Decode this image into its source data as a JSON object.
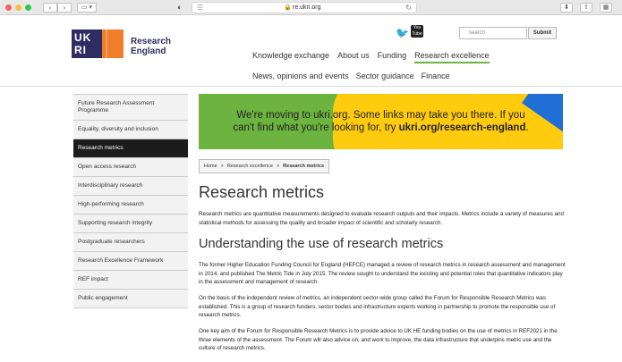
{
  "browser": {
    "url": "re.ukri.org",
    "colors": {
      "close": "#fc605c",
      "minimize": "#fdbc40",
      "maximize": "#34c84a"
    },
    "icons": [
      "back-icon",
      "forward-icon",
      "sidebar-icon",
      "shield-icon",
      "menu-icon",
      "lock-icon",
      "reload-icon",
      "download-icon",
      "share-icon",
      "tabs-icon"
    ]
  },
  "header": {
    "logo_mark": "UK RI",
    "logo_text": "Research England",
    "search_placeholder": "search",
    "submit_label": "Submit",
    "nav": [
      {
        "label": "Knowledge exchange"
      },
      {
        "label": "About us"
      },
      {
        "label": "Funding"
      },
      {
        "label": "Research excellence",
        "active": true
      }
    ],
    "subnav": [
      {
        "label": "News, opinions and events"
      },
      {
        "label": "Sector guidance"
      },
      {
        "label": "Finance"
      }
    ],
    "accent": "#6cb33f"
  },
  "sidebar": {
    "items": [
      {
        "label": "Future Research Assessment Programme"
      },
      {
        "label": "Equality, diversity and inclusion"
      },
      {
        "label": "Research metrics",
        "active": true
      },
      {
        "label": "Open access research"
      },
      {
        "label": "Interdisciplinary research"
      },
      {
        "label": "High-performing research"
      },
      {
        "label": "Supporting research integrity"
      },
      {
        "label": "Postgraduate researchers"
      },
      {
        "label": "Research Excellence Framework"
      },
      {
        "label": "REF impact"
      },
      {
        "label": "Public engagement"
      }
    ]
  },
  "banner": {
    "line1": "We're moving to ukri.org. Some links may take you there. If you",
    "line2_prefix": "can't find what you're looking for, try ",
    "line2_link": "ukri.org/research-england",
    "line2_suffix": "."
  },
  "breadcrumb": {
    "items": [
      "Home",
      "Research excellence",
      "Research metrics"
    ],
    "separator": ">"
  },
  "main": {
    "title": "Research metrics",
    "intro": "Research metrics are quantitative measurements designed to evaluate research outputs and their impacts. Metrics include a variety of measures and statistical methods for assessing the quality and broader impact of scientific and scholarly research.",
    "subtitle": "Understanding the use of research metrics",
    "para1": "The former Higher Education Funding Council for England (HEFCE) managed a review of research metrics in research assessment and management in 2014, and published The Metric Tide in July 2015. The review sought to understand the existing and potential roles that quantitative indicators play in the assessment and management of research.",
    "para2": "On the basis of the independent review of metrics, an independent sector-wide group called the Forum for Responsible Research Metrics was established. This is a group of research funders, sector bodies and infrastructure experts working in partnership to promote the responsible use of research metrics.",
    "para3": "One key aim of the Forum for Responsible Research Metrics is to provide advice to UK HE funding bodies on the use of metrics in REF2021 in the three elements of the assessment. The Forum will also advice on, and work to improve, the data infrastructure that underpins metric use and the culture of research metrics."
  }
}
